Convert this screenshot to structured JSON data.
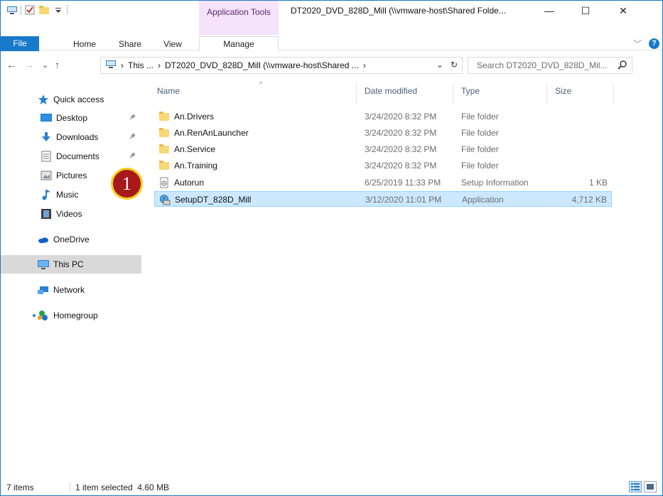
{
  "title": {
    "context_tab": "Application Tools",
    "window_title": "DT2020_DVD_828D_Mill (\\\\vmware-host\\Shared Folde...",
    "minimize": "—",
    "maximize": "☐",
    "close": "✕"
  },
  "ribbon": {
    "tabs": [
      {
        "label": "File"
      },
      {
        "label": "Home"
      },
      {
        "label": "Share"
      },
      {
        "label": "View"
      },
      {
        "label": "Manage"
      }
    ],
    "expand": "﹀",
    "help": "?"
  },
  "address": {
    "back": "←",
    "forward": "→",
    "recent": "⌄",
    "up": "↑",
    "segments": [
      "›",
      "This ...",
      "›",
      "DT2020_DVD_828D_Mill (\\\\vmware-host\\Shared ...",
      "›"
    ],
    "dropdown": "⌄",
    "refresh": "↻",
    "search_placeholder": "Search DT2020_DVD_828D_Mil...",
    "search_icon": "⚲"
  },
  "nav": {
    "items": [
      {
        "label": "Quick access",
        "icon": "star-icon"
      },
      {
        "label": "Desktop",
        "icon": "desktop-icon",
        "pinned": true
      },
      {
        "label": "Downloads",
        "icon": "downloads-icon",
        "pinned": true
      },
      {
        "label": "Documents",
        "icon": "documents-icon",
        "pinned": true
      },
      {
        "label": "Pictures",
        "icon": "pictures-icon"
      },
      {
        "label": "Music",
        "icon": "music-icon"
      },
      {
        "label": "Videos",
        "icon": "videos-icon"
      },
      {
        "label": "OneDrive",
        "icon": "onedrive-icon"
      },
      {
        "label": "This PC",
        "icon": "computer-icon",
        "selected": true
      },
      {
        "label": "Network",
        "icon": "network-icon"
      },
      {
        "label": "Homegroup",
        "icon": "homegroup-icon"
      }
    ],
    "pin_glyph": "📌"
  },
  "columns": {
    "name": "Name",
    "date": "Date modified",
    "type": "Type",
    "size": "Size",
    "sort_indicator": "^"
  },
  "files": [
    {
      "name": "An.Drivers",
      "date": "3/24/2020 8:32 PM",
      "type": "File folder",
      "size": "",
      "icon": "folder-icon"
    },
    {
      "name": "An.RenAnLauncher",
      "date": "3/24/2020 8:32 PM",
      "type": "File folder",
      "size": "",
      "icon": "folder-icon"
    },
    {
      "name": "An.Service",
      "date": "3/24/2020 8:32 PM",
      "type": "File folder",
      "size": "",
      "icon": "folder-icon"
    },
    {
      "name": "An.Training",
      "date": "3/24/2020 8:32 PM",
      "type": "File folder",
      "size": "",
      "icon": "folder-icon"
    },
    {
      "name": "Autorun",
      "date": "6/25/2019 11:33 PM",
      "type": "Setup Information",
      "size": "1 KB",
      "icon": "setup-info-icon"
    },
    {
      "name": "SetupDT_828D_Mill",
      "date": "3/12/2020 11:01 PM",
      "type": "Application",
      "size": "4,712 KB",
      "icon": "installer-icon",
      "selected": true
    }
  ],
  "marker": "1",
  "status": {
    "items": "7 items",
    "selection": "1 item selected  4.60 MB"
  },
  "colors": {
    "accent": "#1979ca",
    "context_tab": "#f5e2fb",
    "selection": "#cce8ff",
    "marker_fill": "#a8191b",
    "marker_ring": "#f2cf1f"
  }
}
